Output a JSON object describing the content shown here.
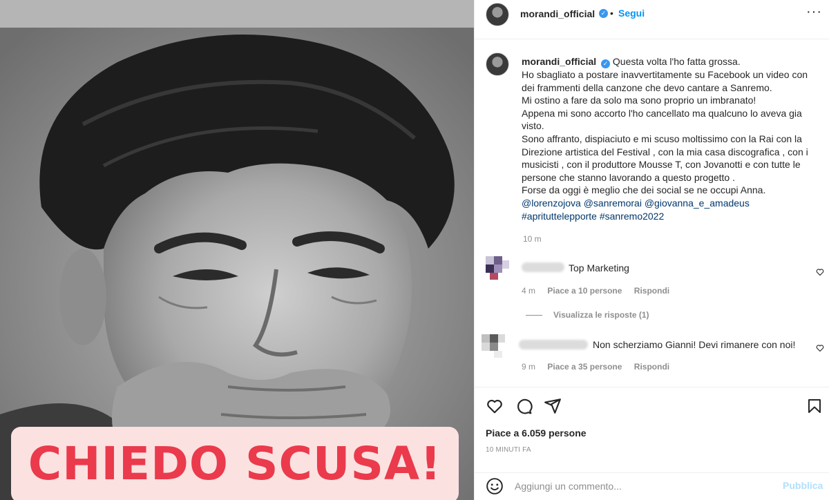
{
  "photo": {
    "caption_text": "CHIEDO SCUSA!",
    "caption_color": "#ea3a4c",
    "caption_bg": "#fce1e1"
  },
  "header": {
    "username": "morandi_official",
    "verified_icon": "verified-badge-icon",
    "separator": "•",
    "follow_label": "Segui",
    "more_icon": "more-options-icon",
    "more_glyph": "···"
  },
  "caption": {
    "username": "morandi_official",
    "lines": [
      "Questa volta l'ho fatta grossa.",
      "Ho sbagliato a postare inavvertitamente su Facebook un video con dei frammenti della canzone che devo cantare a Sanremo.",
      "Mi ostino a fare da solo ma sono proprio un imbranato!",
      "Appena mi sono accorto l'ho cancellato ma qualcuno lo aveva gia visto.",
      "Sono affranto, dispiaciuto e mi scuso moltissimo con la Rai con la Direzione artistica del Festival , con la mia casa discografica , con i musicisti , con il produttore Mousse T, con Jovanotti e con tutte le persone che stanno lavorando a questo progetto .",
      "Forse da oggi è meglio che dei social se ne occupi Anna."
    ],
    "mentions": [
      "@lorenzojova",
      "@sanremorai",
      "@giovanna_e_amadeus"
    ],
    "hashtags": [
      "#aprituttelepporte",
      "#sanremo2022"
    ],
    "time": "10 m"
  },
  "comments": [
    {
      "text": "Top Marketing",
      "time": "4 m",
      "likes": "Piace a 10 persone",
      "reply": "Rispondi"
    },
    {
      "text": "Non scherziamo Gianni! Devi rimanere con noi!",
      "time": "9 m",
      "likes": "Piace a 35 persone",
      "reply": "Rispondi"
    }
  ],
  "view_replies": "Visualizza le risposte (1)",
  "actions": {
    "like_icon": "heart-icon",
    "comment_icon": "comment-icon",
    "share_icon": "share-icon",
    "save_icon": "bookmark-icon"
  },
  "likes_text": "Piace a 6.059 persone",
  "post_time": "10 MINUTI FA",
  "composer": {
    "emoji_icon": "emoji-icon",
    "placeholder": "Aggiungi un commento...",
    "publish_label": "Pubblica",
    "publish_color": "#b2dffc"
  },
  "colors": {
    "link": "#00376b",
    "accent": "#0095f6",
    "muted": "#8e8e8e"
  }
}
